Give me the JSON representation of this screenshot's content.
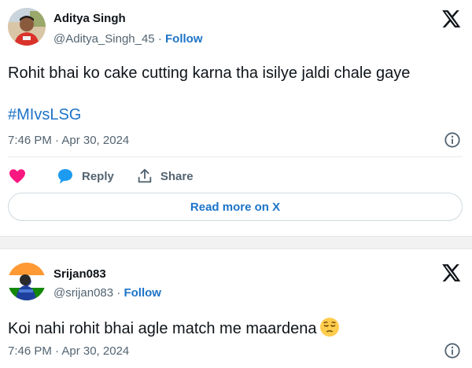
{
  "tweets": [
    {
      "author_name": "Aditya Singh",
      "handle": "@Aditya_Singh_45",
      "separator": " · ",
      "follow_label": "Follow",
      "text": "Rohit bhai ko cake cutting karna tha isilye jaldi chale gaye",
      "hashtag": "#MIvsLSG",
      "timestamp": "7:46 PM · Apr 30, 2024",
      "actions": {
        "reply_label": "Reply",
        "share_label": "Share"
      },
      "read_more_label": "Read more on X",
      "icons": [
        "x-logo-icon",
        "info-icon",
        "heart-icon",
        "reply-bubble-icon",
        "share-icon"
      ]
    },
    {
      "author_name": "Srijan083",
      "handle": "@srijan083",
      "separator": " · ",
      "follow_label": "Follow",
      "text": "Koi nahi rohit bhai agle match me maardena",
      "emoji": "pensive-face",
      "timestamp": "7:46 PM · Apr 30, 2024",
      "icons": [
        "x-logo-icon",
        "info-icon"
      ]
    }
  ],
  "colors": {
    "link": "#1d74c8",
    "secondary_text": "#536471",
    "heart": "#f91880",
    "reply_bubble": "#1d9bf0"
  }
}
